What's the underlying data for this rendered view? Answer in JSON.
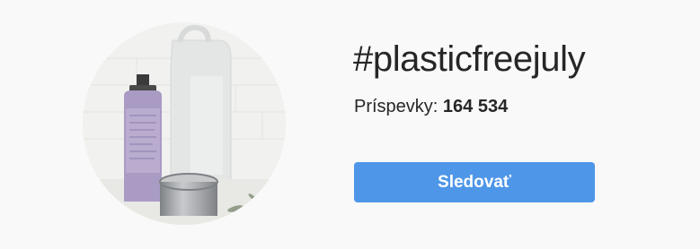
{
  "hashtag": {
    "title": "#plasticfreejuly"
  },
  "stats": {
    "posts_label": "Príspevky:",
    "posts_count": "164 534"
  },
  "actions": {
    "follow_label": "Sledovať"
  },
  "colors": {
    "background": "#f9f9f9",
    "follow_button": "#4e96e8",
    "text": "#262626"
  },
  "avatar": {
    "icon": "hashtag-top-post-image"
  }
}
